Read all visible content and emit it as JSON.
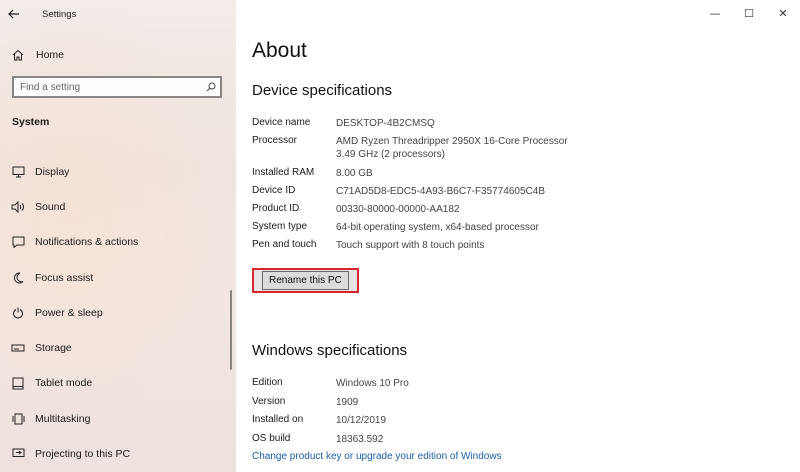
{
  "window": {
    "title": "Settings",
    "controls": {
      "minimize": "—",
      "maximize": "☐",
      "close": "✕"
    }
  },
  "sidebar": {
    "home_label": "Home",
    "search_placeholder": "Find a setting",
    "section_label": "System",
    "items": [
      {
        "label": "Display",
        "icon": "monitor-icon"
      },
      {
        "label": "Sound",
        "icon": "speaker-icon"
      },
      {
        "label": "Notifications & actions",
        "icon": "notifications-icon"
      },
      {
        "label": "Focus assist",
        "icon": "moon-icon"
      },
      {
        "label": "Power & sleep",
        "icon": "power-icon"
      },
      {
        "label": "Storage",
        "icon": "storage-icon"
      },
      {
        "label": "Tablet mode",
        "icon": "tablet-icon"
      },
      {
        "label": "Multitasking",
        "icon": "multitasking-icon"
      },
      {
        "label": "Projecting to this PC",
        "icon": "projecting-icon"
      }
    ]
  },
  "main": {
    "page_title": "About",
    "device_specs": {
      "title": "Device specifications",
      "rows": [
        {
          "key": "Device name",
          "value": "DESKTOP-4B2CMSQ"
        },
        {
          "key": "Processor",
          "value": "AMD Ryzen Threadripper 2950X 16-Core Processor",
          "value2": "3.49 GHz  (2 processors)"
        },
        {
          "key": "Installed RAM",
          "value": "8.00 GB"
        },
        {
          "key": "Device ID",
          "value": "C71AD5D8-EDC5-4A93-B6C7-F35774605C4B"
        },
        {
          "key": "Product ID",
          "value": "00330-80000-00000-AA182"
        },
        {
          "key": "System type",
          "value": "64-bit operating system, x64-based processor"
        },
        {
          "key": "Pen and touch",
          "value": "Touch support with 8 touch points"
        }
      ],
      "rename_button": "Rename this PC"
    },
    "windows_specs": {
      "title": "Windows specifications",
      "rows": [
        {
          "key": "Edition",
          "value": "Windows 10 Pro"
        },
        {
          "key": "Version",
          "value": "1909"
        },
        {
          "key": "Installed on",
          "value": "10/12/2019"
        },
        {
          "key": "OS build",
          "value": "18363.592"
        }
      ],
      "link": "Change product key or upgrade your edition of Windows"
    }
  },
  "colors": {
    "accent_link": "#1a5fa8",
    "highlight_border": "#d7262e"
  }
}
